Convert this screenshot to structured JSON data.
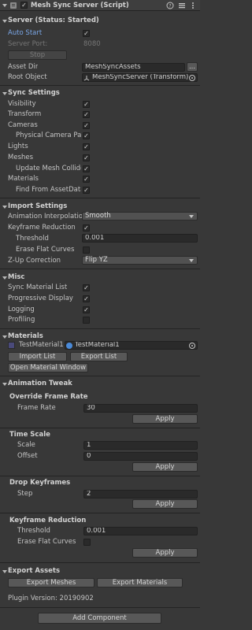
{
  "component": {
    "title": "Mesh Sync Server (Script)",
    "enabled": true
  },
  "server": {
    "title": "Server (Status: Started)",
    "auto_start_label": "Auto Start",
    "auto_start": true,
    "port_label": "Server Port:",
    "port_value": "8080",
    "stop_label": "Stop",
    "asset_dir_label": "Asset Dir",
    "asset_dir_value": "MeshSyncAssets",
    "asset_dir_browse": "...",
    "root_object_label": "Root Object",
    "root_object_value": "MeshSyncServer (Transform)"
  },
  "sync_settings": {
    "title": "Sync Settings",
    "items": [
      {
        "label": "Visibility",
        "checked": true
      },
      {
        "label": "Transform",
        "checked": true
      },
      {
        "label": "Cameras",
        "checked": true
      },
      {
        "label": "Physical Camera Params",
        "checked": true
      },
      {
        "label": "Lights",
        "checked": true
      },
      {
        "label": "Meshes",
        "checked": true
      },
      {
        "label": "Update Mesh Colliders",
        "checked": true
      },
      {
        "label": "Materials",
        "checked": true
      },
      {
        "label": "Find From AssetDatabase",
        "checked": true
      }
    ]
  },
  "import_settings": {
    "title": "Import Settings",
    "interp_label": "Animation Interpolation",
    "interp_value": "Smooth",
    "keyframe_label": "Keyframe Reduction",
    "keyframe_checked": true,
    "threshold_label": "Threshold",
    "threshold_value": "0.001",
    "erase_label": "Erase Flat Curves",
    "erase_checked": false,
    "zup_label": "Z-Up Correction",
    "zup_value": "Flip YZ"
  },
  "misc": {
    "title": "Misc",
    "items": [
      {
        "label": "Sync Material List",
        "checked": true
      },
      {
        "label": "Progressive Display",
        "checked": true
      },
      {
        "label": "Logging",
        "checked": true
      },
      {
        "label": "Profiling",
        "checked": false
      }
    ]
  },
  "materials": {
    "title": "Materials",
    "row_label": "TestMaterial1",
    "row_value": "TestMaterial1",
    "swatch_color": "#4a4a7a",
    "import_label": "Import List",
    "export_label": "Export List",
    "open_window_label": "Open Material Window"
  },
  "animation_tweak": {
    "title": "Animation Tweak",
    "override": {
      "title": "Override Frame Rate",
      "frame_rate_label": "Frame Rate",
      "frame_rate_value": "30",
      "apply_label": "Apply"
    },
    "time_scale": {
      "title": "Time Scale",
      "scale_label": "Scale",
      "scale_value": "1",
      "offset_label": "Offset",
      "offset_value": "0",
      "apply_label": "Apply"
    },
    "drop_keyframes": {
      "title": "Drop Keyframes",
      "step_label": "Step",
      "step_value": "2",
      "apply_label": "Apply"
    },
    "keyframe_reduction": {
      "title": "Keyframe Reduction",
      "threshold_label": "Threshold",
      "threshold_value": "0.001",
      "erase_label": "Erase Flat Curves",
      "erase_checked": false,
      "apply_label": "Apply"
    }
  },
  "export_assets": {
    "title": "Export Assets",
    "meshes_label": "Export Meshes",
    "materials_label": "Export Materials"
  },
  "plugin_version": "Plugin Version: 20190902",
  "add_component_label": "Add Component",
  "icons": {
    "script": "script-icon",
    "help": "help-icon",
    "settings": "settings-icon",
    "more": "more-icon",
    "check": "✓"
  }
}
